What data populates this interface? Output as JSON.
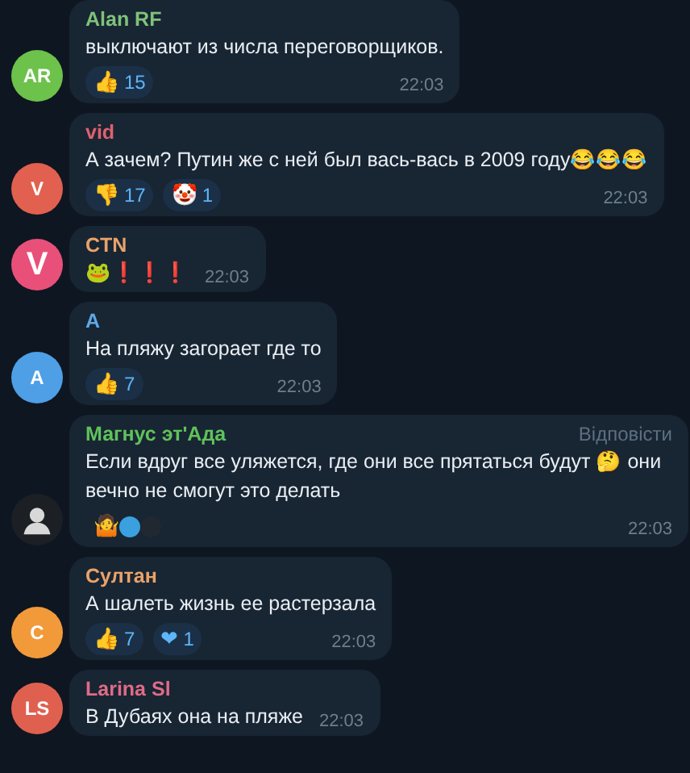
{
  "messages": [
    {
      "author": "Alan RF",
      "color": "#7fc27a",
      "avatar": {
        "kind": "initials",
        "text": "AR",
        "color": "#6cc24a"
      },
      "text": "выключают из числа переговорщиков.",
      "reactions": [
        {
          "kind": "emoji",
          "emoji": "👍",
          "count": "15"
        }
      ],
      "time": "22:03"
    },
    {
      "author": "vid",
      "color": "#e0606e",
      "avatar": {
        "kind": "initials",
        "text": "V",
        "color": "#e2604f"
      },
      "text": "А зачем? Путин же с ней был вась-вась в 2009 году😂😂😂",
      "reactions": [
        {
          "kind": "emoji",
          "emoji": "👎",
          "count": "17"
        },
        {
          "kind": "emoji",
          "emoji": "🤡",
          "count": "1"
        }
      ],
      "time": "22:03"
    },
    {
      "author": "CTN",
      "color": "#e9a36a",
      "avatar": {
        "kind": "logo",
        "text": "V",
        "color": "#e8507a"
      },
      "text": "🐸❗❗❗",
      "time": "22:03"
    },
    {
      "author": "A",
      "color": "#5ea8e8",
      "avatar": {
        "kind": "initials",
        "text": "A",
        "color": "#4e9fe6"
      },
      "text": "На пляжу загорает где то",
      "reactions": [
        {
          "kind": "emoji",
          "emoji": "👍",
          "count": "7"
        }
      ],
      "time": "22:03"
    },
    {
      "author": "Магнус эт'Ада",
      "color": "#5fc25a",
      "avatar": {
        "kind": "picture",
        "color": "#1c1f24"
      },
      "reply": "Відповісти",
      "text": "Если вдруг все уляжется, где они все прятаться будут 🤔 они вечно не смогут это делать",
      "reactions": [
        {
          "kind": "emoji-with-avatars",
          "emoji": "🤷",
          "avatars": [
            {
              "color": "#3aa0e0"
            },
            {
              "color": "#222831"
            }
          ]
        }
      ],
      "time": "22:03"
    },
    {
      "author": "Султан",
      "color": "#e9a36a",
      "avatar": {
        "kind": "initials",
        "text": "С",
        "color": "#f29a3a"
      },
      "text": "А шалеть жизнь ее растерзала",
      "reactions": [
        {
          "kind": "emoji",
          "emoji": "👍",
          "count": "7"
        },
        {
          "kind": "emoji",
          "emoji": "❤",
          "count": "1"
        }
      ],
      "time": "22:03"
    },
    {
      "author": "Larina Sl",
      "color": "#e06b86",
      "avatar": {
        "kind": "initials",
        "text": "LS",
        "color": "#e0604f"
      },
      "text": "В Дубаях она на пляже",
      "time": "22:03"
    }
  ]
}
